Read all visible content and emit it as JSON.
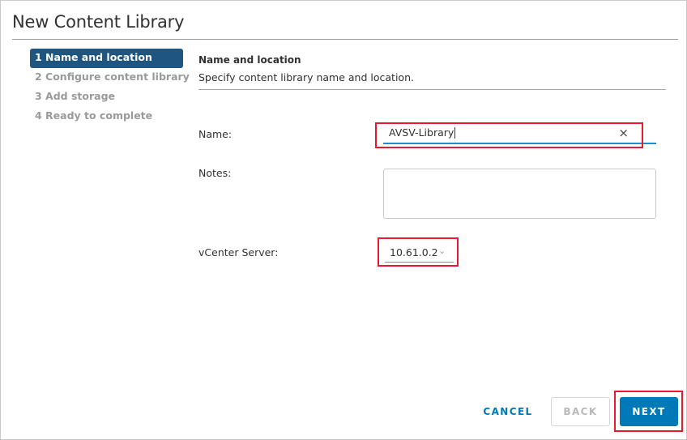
{
  "dialog": {
    "title": "New Content Library"
  },
  "steps": [
    {
      "label": "1 Name and location",
      "active": true
    },
    {
      "label": "2 Configure content library",
      "active": false
    },
    {
      "label": "3 Add storage",
      "active": false
    },
    {
      "label": "4 Ready to complete",
      "active": false
    }
  ],
  "section": {
    "title": "Name and location",
    "description": "Specify content library name and location."
  },
  "form": {
    "name_label": "Name:",
    "name_value": "AVSV-Library",
    "clear_icon": "×",
    "notes_label": "Notes:",
    "notes_value": "",
    "vcenter_label": "vCenter Server:",
    "vcenter_value": "10.61.0.2",
    "chevron_icon": "⌄"
  },
  "buttons": {
    "cancel": "CANCEL",
    "back": "BACK",
    "next": "NEXT"
  },
  "colors": {
    "accent": "#0079b8",
    "active_step": "#1f5581",
    "highlight": "#e8192f",
    "input_focus": "#1a8fd0"
  }
}
